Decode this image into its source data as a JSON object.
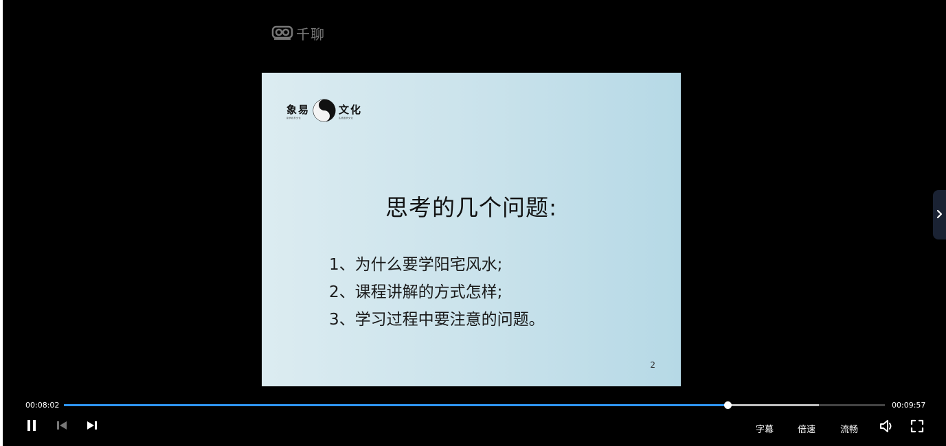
{
  "watermark": {
    "text": "千聊",
    "icon": "video-camera-logo-icon"
  },
  "slide": {
    "logo": {
      "left_text": "象易",
      "right_text": "文化",
      "left_sub": "易学视界文化",
      "right_sub": "弘扬国学文化",
      "emblem": "yin-yang-icon"
    },
    "title": "思考的几个问题:",
    "items": [
      "1、为什么要学阳宅风水;",
      "2、课程讲解的方式怎样;",
      "3、学习过程中要注意的问题。"
    ],
    "page_number": "2"
  },
  "player": {
    "current_time": "00:08:02",
    "total_time": "00:09:57",
    "progress_fraction": 0.808,
    "buffered_fraction": 0.92,
    "controls": {
      "subtitle_label": "字幕",
      "speed_label": "倍速",
      "quality_label": "流畅"
    },
    "icons": [
      "pause-icon",
      "previous-icon",
      "next-icon",
      "volume-icon",
      "fullscreen-icon",
      "chevron-right-icon"
    ],
    "colors": {
      "played": "#2f96f5",
      "buffered": "#c0c0c0",
      "track": "#444444"
    }
  }
}
